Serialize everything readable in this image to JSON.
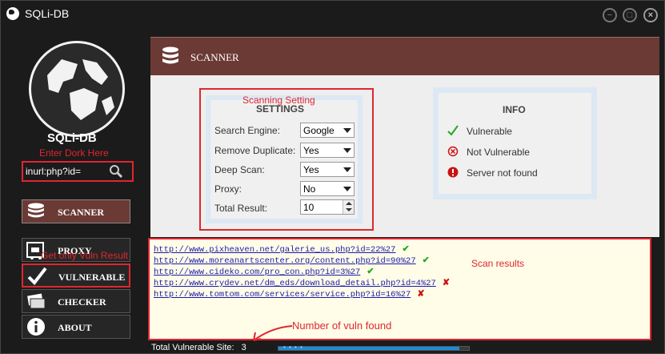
{
  "window": {
    "title": "SQLi-DB",
    "controls": {
      "minimize": "−",
      "maximize": "□",
      "close": "×"
    }
  },
  "sidebar": {
    "app_name": "SQLi-DB",
    "search": {
      "value": "inurl:php?id=",
      "icon": "search-icon"
    },
    "nav": [
      {
        "id": "scanner",
        "label": "SCANNER",
        "icon": "database-icon",
        "active": true
      },
      {
        "id": "proxy",
        "label": "PROXY",
        "icon": "proxy-icon"
      },
      {
        "id": "vulnerable",
        "label": "VULNERABLE",
        "icon": "checkmark-icon"
      },
      {
        "id": "checker",
        "label": "CHECKER",
        "icon": "cards-icon"
      },
      {
        "id": "about",
        "label": "ABOUT",
        "icon": "info-icon"
      }
    ]
  },
  "annotations": {
    "enter_dork": "Enter Dork Here",
    "scanning_setting": "Scanning Setting",
    "vuln_result": "Get only Vuln Result",
    "scan_results": "Scan results",
    "number_vuln": "Number of vuln found"
  },
  "header": {
    "title": "SCANNER"
  },
  "settings": {
    "title": "SETTINGS",
    "fields": [
      {
        "label": "Search Engine:",
        "value": "Google"
      },
      {
        "label": "Remove Duplicate:",
        "value": "Yes"
      },
      {
        "label": "Deep Scan:",
        "value": "Yes"
      },
      {
        "label": "Proxy:",
        "value": "No"
      },
      {
        "label": "Total Result:",
        "value": "10"
      }
    ]
  },
  "info": {
    "title": "INFO",
    "legend": [
      {
        "label": "Vulnerable",
        "icon": "check-icon",
        "color": "#22aa22"
      },
      {
        "label": "Not Vulnerable",
        "icon": "circle-x-icon",
        "color": "#cc1111"
      },
      {
        "label": "Server not found",
        "icon": "alert-icon",
        "color": "#cc1111"
      }
    ]
  },
  "results": [
    {
      "url": "http://www.pixheaven.net/galerie_us.php?id=22%27",
      "status": "vulnerable",
      "mark": "✔"
    },
    {
      "url": "http://www.moreanartscenter.org/content.php?id=90%27",
      "status": "vulnerable",
      "mark": "✔"
    },
    {
      "url": "http://www.cideko.com/pro_con.php?id=3%27",
      "status": "vulnerable",
      "mark": "✔"
    },
    {
      "url": "http://www.crydev.net/dm_eds/download_detail.php?id=4%27",
      "status": "not-vulnerable",
      "mark": "✘"
    },
    {
      "url": "http://www.tomtom.com/services/service.php?id=16%27",
      "status": "not-vulnerable",
      "mark": "✘"
    }
  ],
  "status": {
    "total_label": "Total Vulnerable Site:",
    "total_value": "3",
    "progress_fraction": 0.95,
    "progress_indicator": "• • • •"
  },
  "colors": {
    "accent": "#6b3a35",
    "annotation": "#e0262f",
    "background": "#1b1b1b",
    "link": "#1a1aaa"
  }
}
